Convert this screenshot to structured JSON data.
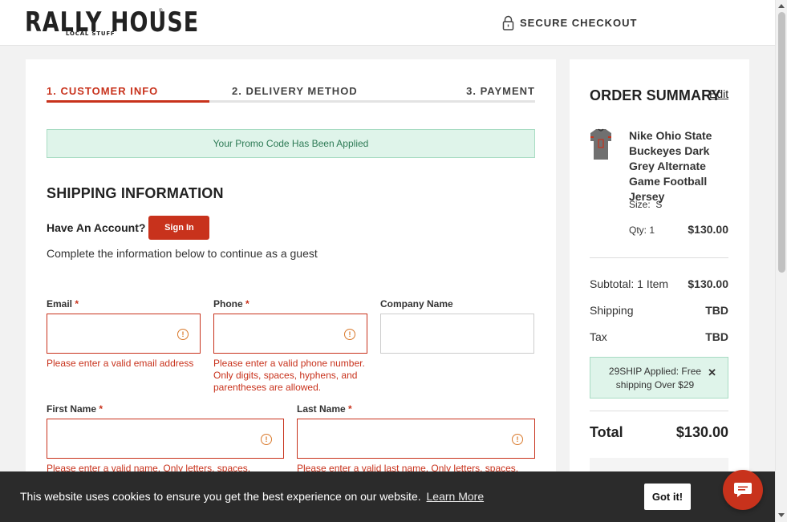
{
  "header": {
    "logo_main": "RALLY HOUSE",
    "logo_sub": "LOCAL STUFF",
    "logo_tm": "®",
    "secure_checkout": "SECURE CHECKOUT",
    "secure_icon": "lock-icon"
  },
  "steps": [
    {
      "label": "1. CUSTOMER INFO",
      "active": true
    },
    {
      "label": "2. DELIVERY METHOD",
      "active": false
    },
    {
      "label": "3. PAYMENT",
      "active": false
    }
  ],
  "promo_banner": "Your Promo Code Has Been Applied",
  "shipping": {
    "title": "SHIPPING INFORMATION",
    "account_prompt": "Have An Account?",
    "sign_in": "Sign In",
    "guest_text": "Complete the information below to continue as a guest",
    "fields": {
      "email": {
        "label": "Email",
        "required": "*",
        "value": "",
        "error": "Please enter a valid email address"
      },
      "phone": {
        "label": "Phone",
        "required": "*",
        "value": "",
        "error_lines": [
          "Please enter a valid phone number.",
          "Only digits, spaces, hyphens, and",
          "parentheses are allowed."
        ]
      },
      "company": {
        "label": "Company Name",
        "value": ""
      },
      "first_name": {
        "label": "First Name",
        "required": "*",
        "value": "",
        "error": "Please enter a valid name. Only letters, spaces,"
      },
      "last_name": {
        "label": "Last Name",
        "required": "*",
        "value": "",
        "error": "Please enter a valid last name. Only letters, spaces,"
      }
    }
  },
  "summary": {
    "title": "ORDER SUMMARY",
    "edit": "Edit",
    "product": {
      "name": "Nike Ohio State Buckeyes Dark Grey Alternate Game Football Jersey",
      "size_label": "Size:",
      "size": "S",
      "qty": "Qty: 1",
      "price": "$130.00"
    },
    "subtotal_label": "Subtotal: 1 Item",
    "subtotal": "$130.00",
    "shipping_label": "Shipping",
    "shipping": "TBD",
    "tax_label": "Tax",
    "tax": "TBD",
    "ship_promo": "29SHIP Applied: Free shipping Over $29",
    "ship_promo_close": "✕",
    "total_label": "Total",
    "total": "$130.00"
  },
  "cookie": {
    "text": "This website uses cookies to ensure you get the best experience on our website.",
    "link": "Learn More",
    "button": "Got it!"
  },
  "colors": {
    "accent": "#c8321c",
    "success_bg": "#dff4ea",
    "success_text": "#2d7a55",
    "cookie_bg": "#2b2b2b"
  }
}
